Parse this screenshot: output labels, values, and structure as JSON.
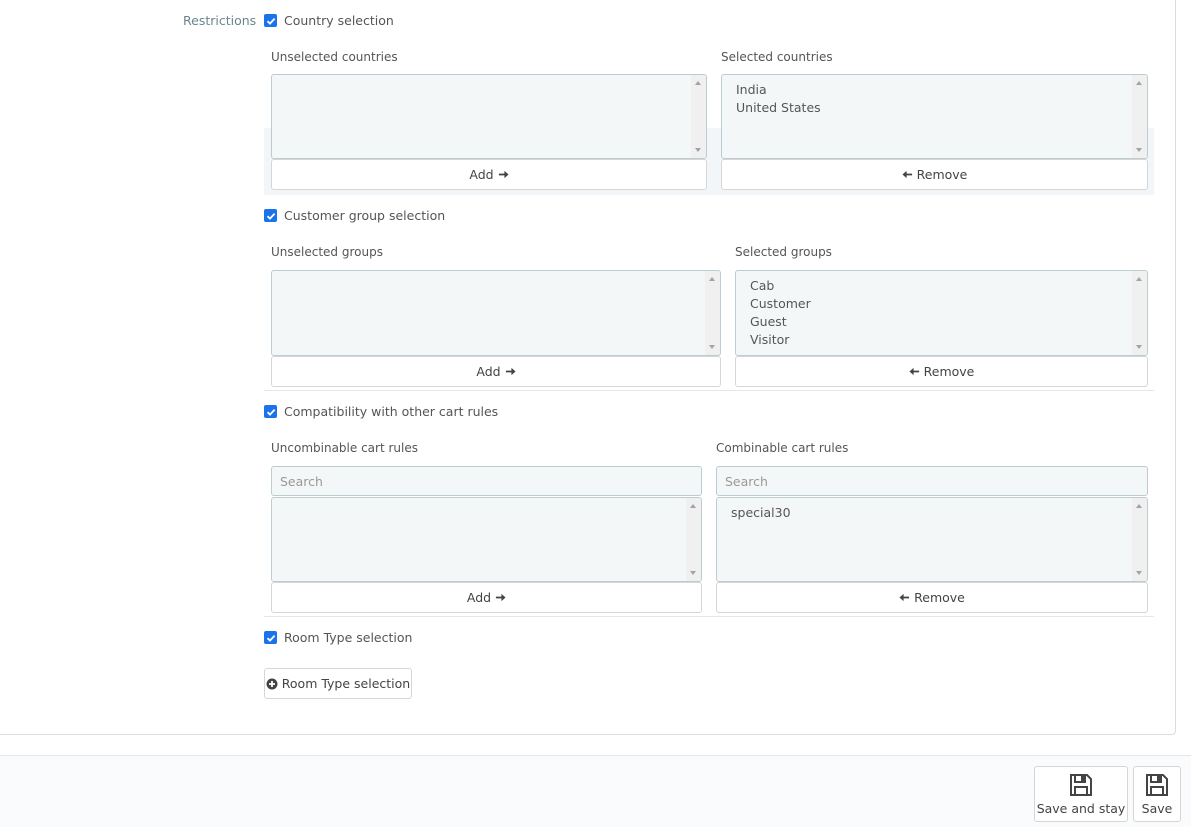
{
  "restrictions": {
    "label": "Restrictions",
    "country": {
      "checkbox_label": "Country selection",
      "checked": true,
      "unselected_label": "Unselected countries",
      "unselected_items": [],
      "selected_label": "Selected countries",
      "selected_items": [
        "India",
        "United States"
      ],
      "add_label": "Add",
      "remove_label": "Remove"
    },
    "customer_group": {
      "checkbox_label": "Customer group selection",
      "checked": true,
      "unselected_label": "Unselected groups",
      "unselected_items": [],
      "selected_label": "Selected groups",
      "selected_items": [
        "Cab",
        "Customer",
        "Guest",
        "Visitor"
      ],
      "add_label": "Add",
      "remove_label": "Remove"
    },
    "cart_rules": {
      "checkbox_label": "Compatibility with other cart rules",
      "checked": true,
      "uncombinable_label": "Uncombinable cart rules",
      "uncombinable_search_placeholder": "Search",
      "uncombinable_items": [],
      "combinable_label": "Combinable cart rules",
      "combinable_search_placeholder": "Search",
      "combinable_items": [
        "special30"
      ],
      "add_label": "Add",
      "remove_label": "Remove"
    },
    "room_type": {
      "checkbox_label": "Room Type selection",
      "checked": true,
      "button_label": "Room Type selection"
    }
  },
  "footer": {
    "save_and_stay_label": "Save and stay",
    "save_label": "Save"
  },
  "colors": {
    "checkbox": "#1a73e8",
    "listbox_bg": "#f4f7f8",
    "listbox_border": "#bbcdd2"
  }
}
